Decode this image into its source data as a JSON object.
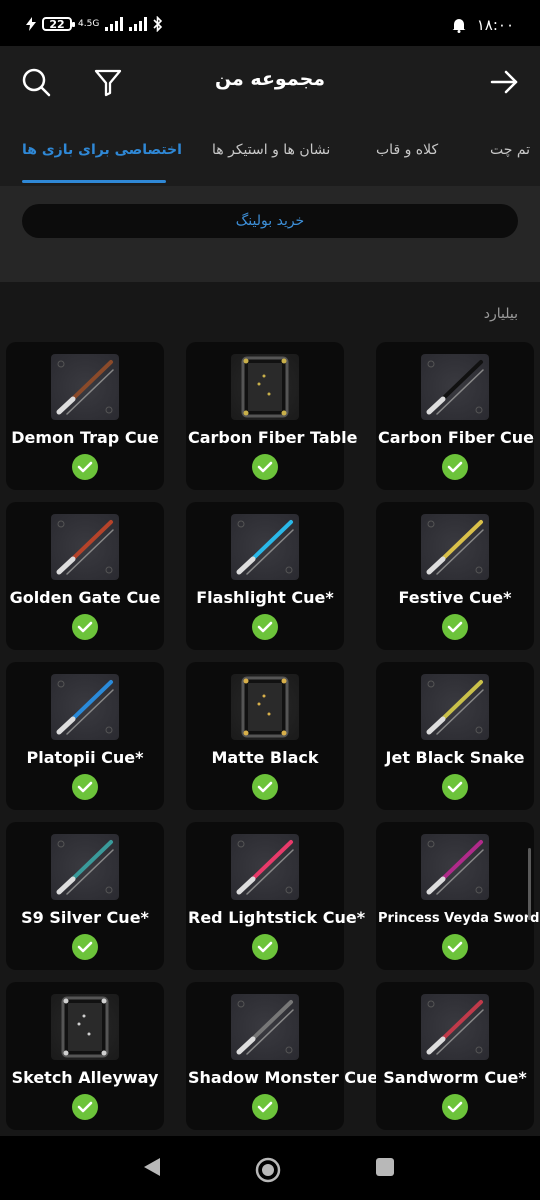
{
  "status_bar": {
    "battery": "22",
    "network": "4.5G",
    "time": "۱۸:۰۰",
    "icons": [
      "lightning-icon",
      "signal-icon",
      "bluetooth-icon",
      "alarm-icon"
    ]
  },
  "header": {
    "title": "مجموعه من",
    "icons": [
      "search-icon",
      "filter-icon",
      "arrow-right-icon"
    ]
  },
  "tabs": [
    {
      "label": "اختصاصی برای بازی ها",
      "active": true
    },
    {
      "label": "نشان ها و استیکر ها",
      "active": false
    },
    {
      "label": "کلاه و قاب",
      "active": false
    },
    {
      "label": "تم چت",
      "active": false
    }
  ],
  "promo": {
    "label": "خرید بولینگ"
  },
  "section": {
    "title": "بیلیارد"
  },
  "items": [
    {
      "name": "Demon Trap Cue",
      "owned": true,
      "kind": "cue",
      "color": "#8a4a2a"
    },
    {
      "name": "Carbon Fiber Table",
      "owned": true,
      "kind": "table",
      "color": "#c9b04a"
    },
    {
      "name": "Carbon Fiber Cue",
      "owned": true,
      "kind": "cue",
      "color": "#111111"
    },
    {
      "name": "Golden Gate Cue",
      "owned": true,
      "kind": "cue",
      "color": "#b5432a"
    },
    {
      "name": "Flashlight Cue*",
      "owned": true,
      "kind": "cue",
      "color": "#2ab8e8"
    },
    {
      "name": "Festive Cue*",
      "owned": true,
      "kind": "cue",
      "color": "#d9c04a"
    },
    {
      "name": "Platopii Cue*",
      "owned": true,
      "kind": "cue",
      "color": "#2a8ad9"
    },
    {
      "name": "Matte Black",
      "owned": true,
      "kind": "table",
      "color": "#d9b04a"
    },
    {
      "name": "Jet Black Snake",
      "owned": true,
      "kind": "cue",
      "color": "#c9c04a"
    },
    {
      "name": "S9 Silver Cue*",
      "owned": true,
      "kind": "cue",
      "color": "#3a9a9a"
    },
    {
      "name": "Red Lightstick Cue*",
      "owned": true,
      "kind": "cue",
      "color": "#e83a6a"
    },
    {
      "name": "Princess Veyda Sword",
      "owned": true,
      "kind": "cue",
      "color": "#b02a8a"
    },
    {
      "name": "Sketch Alleyway",
      "owned": true,
      "kind": "table",
      "color": "#d0d0d0"
    },
    {
      "name": "Shadow Monster Cue",
      "owned": true,
      "kind": "cue",
      "color": "#777777"
    },
    {
      "name": "Sandworm Cue*",
      "owned": true,
      "kind": "cue",
      "color": "#c03a4a"
    }
  ],
  "nav": {
    "icons": [
      "back-icon",
      "home-icon",
      "recents-icon"
    ]
  },
  "colors": {
    "accent": "#2f88d6",
    "check": "#6cc33a"
  }
}
